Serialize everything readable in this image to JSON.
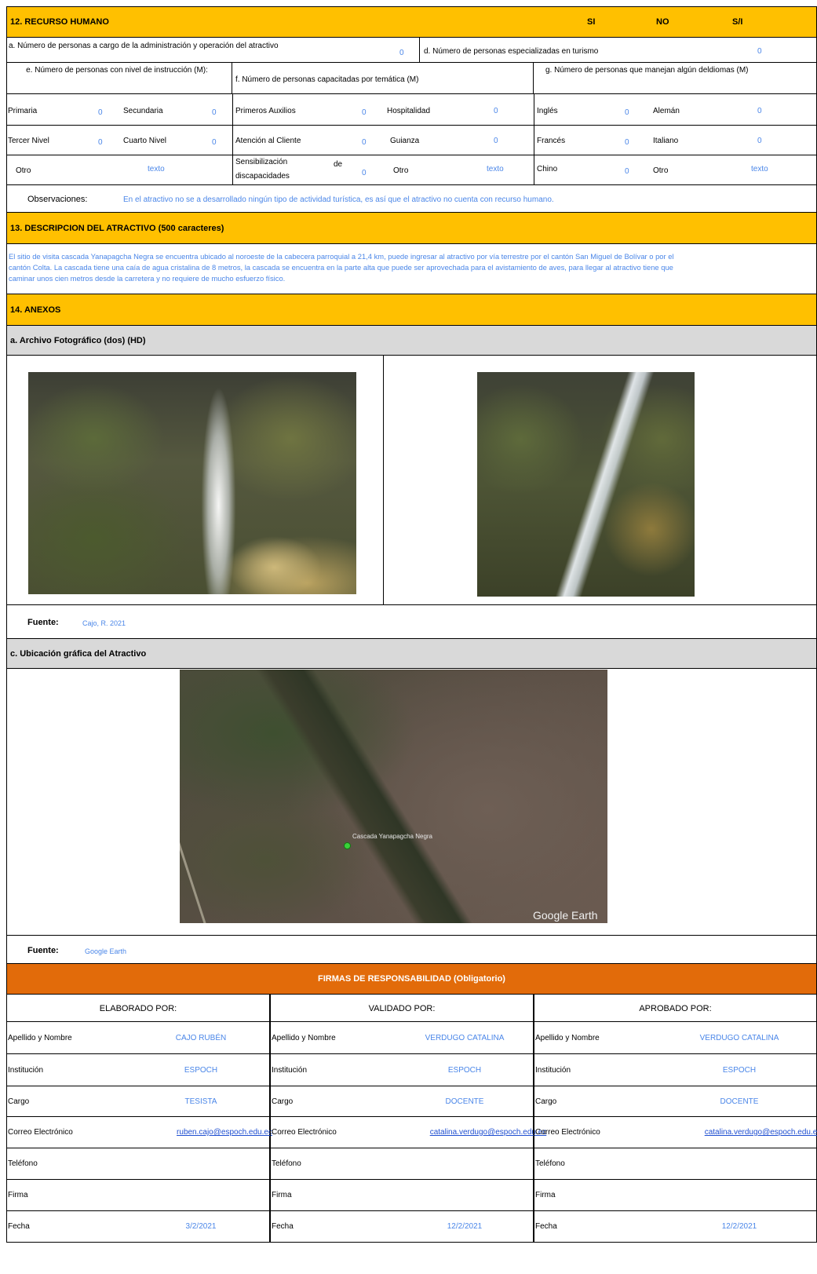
{
  "s12": {
    "title": "12. RECURSO HUMANO",
    "col_si": "SI",
    "col_no": "NO",
    "col_si2": "S/I",
    "a_label": "a. Número de personas a cargo de la administración y operación del atractivo",
    "a_val": "0",
    "d_label": "d. Número de personas especializadas en turismo",
    "d_val": "0",
    "e_label": "e. Número de personas con nivel de instrucción (M):",
    "f_label": "f. Número de personas capacitadas por temática (M)",
    "g_label": "g. Número de personas que manejan algún deldiomas (M)",
    "e_items": {
      "primaria": "Primaria",
      "primaria_v": "0",
      "secundaria": "Secundaria",
      "secundaria_v": "0",
      "tercer": "Tercer Nivel",
      "tercer_v": "0",
      "cuarto": "Cuarto Nivel",
      "cuarto_v": "0",
      "otro": "Otro",
      "otro_v": "texto"
    },
    "f_items": {
      "aux": "Primeros Auxilios",
      "aux_v": "0",
      "hosp": "Hospitalidad",
      "hosp_v": "0",
      "aten": "Atención al Cliente",
      "aten_v": "0",
      "guia": "Guianza",
      "guia_v": "0",
      "sens1": "Sensibilización",
      "sens_de": "de",
      "sens2": "discapacidades",
      "sens_v": "0",
      "otro": "Otro",
      "otro_v": "texto"
    },
    "g_items": {
      "ing": "Inglés",
      "ing_v": "0",
      "ale": "Alemán",
      "ale_v": "0",
      "fra": "Francés",
      "fra_v": "0",
      "ita": "Italiano",
      "ita_v": "0",
      "chi": "Chino",
      "chi_v": "0",
      "otro": "Otro",
      "otro_v": "texto"
    },
    "obs_label": "Observaciones:",
    "obs_text": "En el atractivo no se a desarrollado ningún tipo de actividad turística, es así que el atractivo no cuenta con recurso humano."
  },
  "s13": {
    "title": "13. DESCRIPCION DEL ATRACTIVO (500 caracteres)",
    "lines": [
      "El sitio de visita cascada Yanapagcha Negra se encuentra ubicado al noroeste de la cabecera parroquial a 21,4 km, puede ingresar al atractivo por vía terrestre por el  cantón San Miguel de Bolívar o por el",
      "cantón Colta. La cascada tiene una caía de agua cristalina de 8 metros, la cascada se encuentra en la parte alta que puede ser aprovechada para el avistamiento de aves, para llegar al atractivo tiene que",
      "caminar unos cien metros desde la carretera y no requiere de mucho esfuerzo físico."
    ]
  },
  "s14": {
    "title": "14. ANEXOS",
    "photo_title": "a. Archivo Fotográfico (dos) (HD)",
    "fuente_label": "Fuente:",
    "fuente1": "Cajo, R. 2021",
    "map_title": "c. Ubicación gráfica del Atractivo",
    "map_pin": "Cascada Yanapagcha Negra",
    "map_brand": "Google Earth",
    "fuente2": "Google Earth"
  },
  "firmas": {
    "title": "FIRMAS DE RESPONSABILIDAD (Obligatorio)",
    "cols": [
      {
        "head": "ELABORADO POR:",
        "nombre": "CAJO RUBÉN",
        "inst": "ESPOCH",
        "cargo": "TESISTA",
        "correo": "ruben.cajo@espoch.edu.ec",
        "fecha": "3/2/2021"
      },
      {
        "head": "VALIDADO POR:",
        "nombre": "VERDUGO CATALINA",
        "inst": "ESPOCH",
        "cargo": "DOCENTE",
        "correo": "catalina.verdugo@espoch.edu.ec",
        "fecha": "12/2/2021"
      },
      {
        "head": "APROBADO POR:",
        "nombre": "VERDUGO CATALINA",
        "inst": "ESPOCH",
        "cargo": "DOCENTE",
        "correo": "catalina.verdugo@espoch.edu.ec",
        "fecha": "12/2/2021"
      }
    ],
    "labels": {
      "nombre": "Apellido y Nombre",
      "inst": "Institución",
      "cargo": "Cargo",
      "correo": "Correo Electrónico",
      "tel": "Teléfono",
      "firma": "Firma",
      "fecha": "Fecha"
    }
  }
}
